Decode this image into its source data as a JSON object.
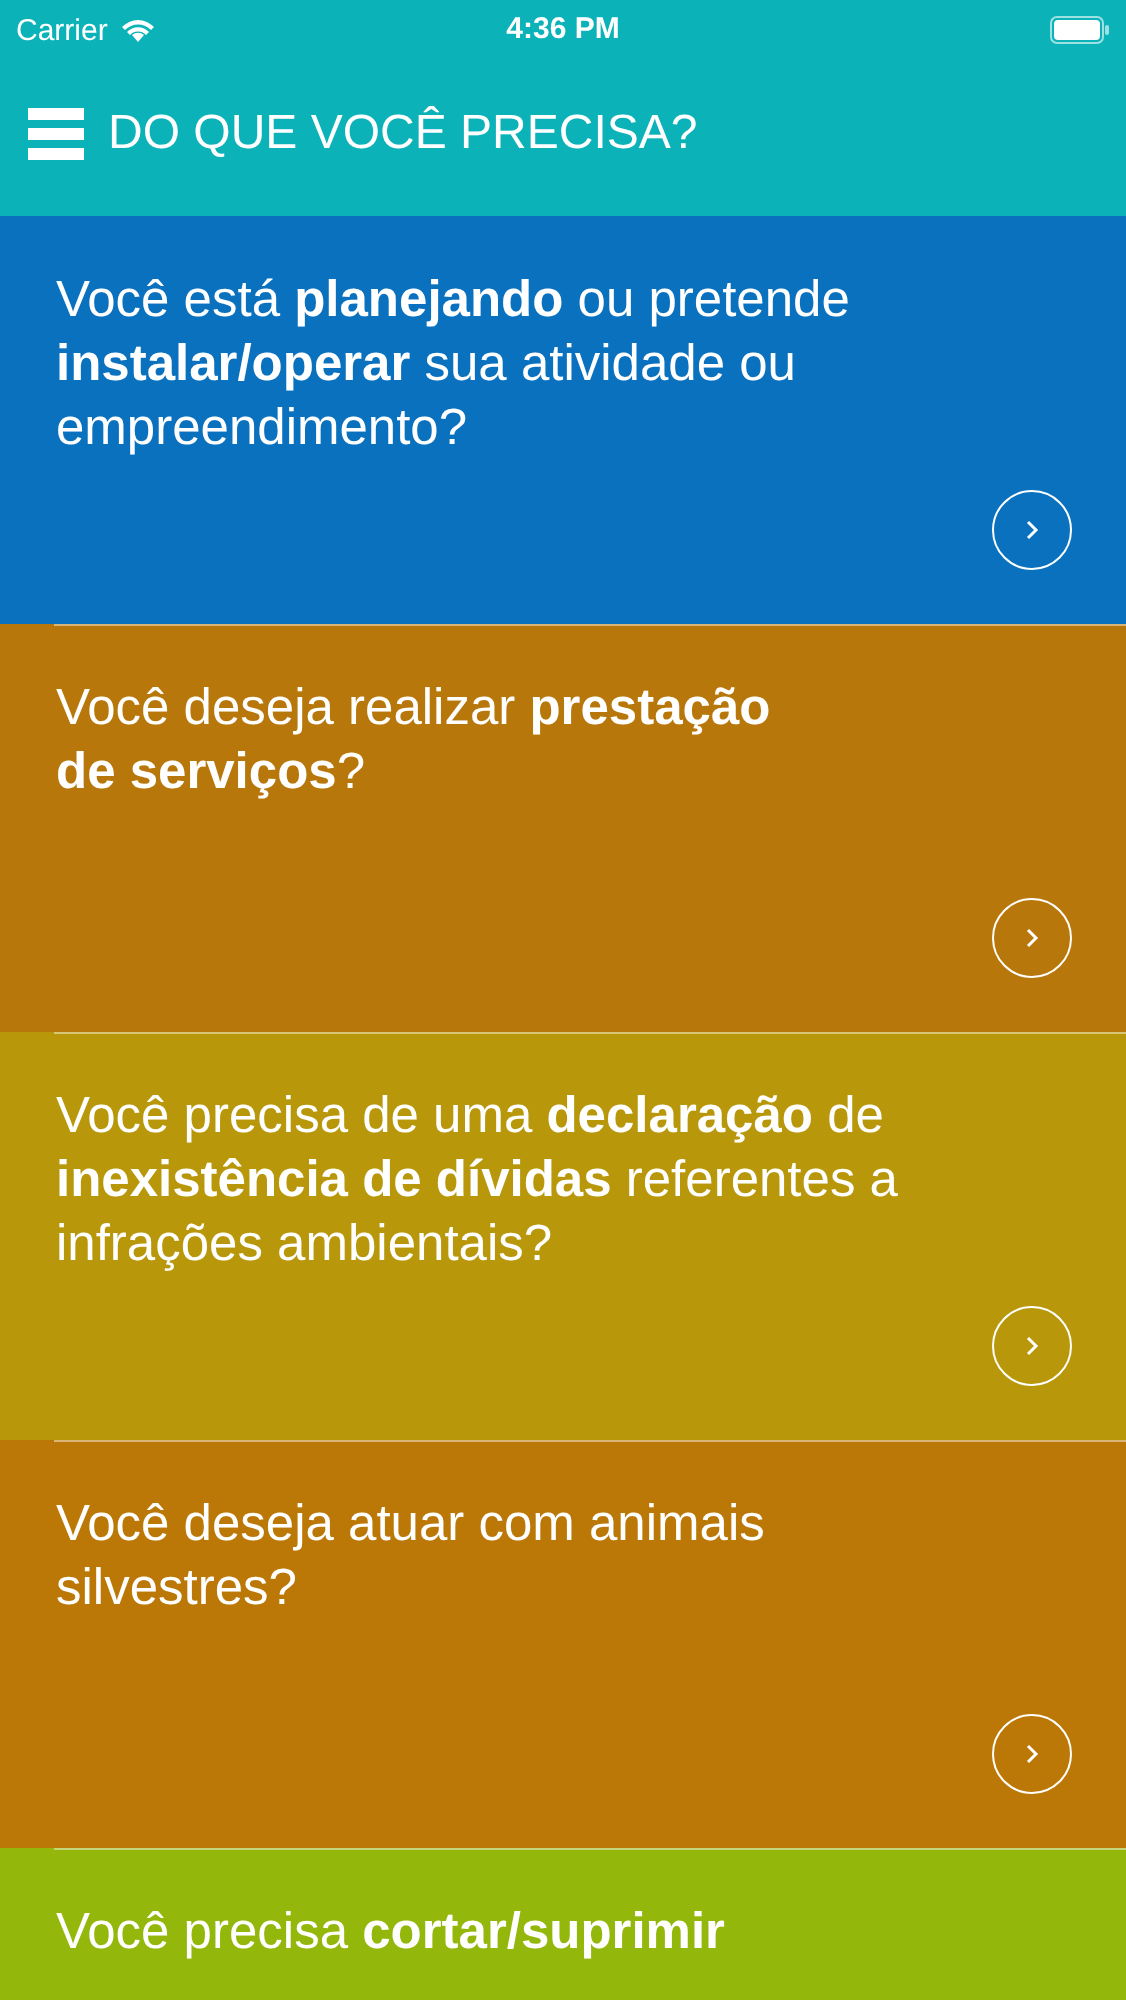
{
  "status_bar": {
    "carrier": "Carrier",
    "time": "4:36 PM"
  },
  "nav": {
    "title": "DO QUE VOCÊ PRECISA?"
  },
  "cards": [
    {
      "lines": [
        "Você está **planejando** ou pretende",
        "**instalar/operar** sua atividade ou",
        "empreendimento?"
      ],
      "color": "#0a71bf",
      "has_button": true
    },
    {
      "lines": [
        "Você deseja realizar **prestação**",
        "**de serviços**?"
      ],
      "color": "#b8770a",
      "has_button": true
    },
    {
      "lines": [
        "Você precisa de uma **declaração** de",
        "**inexistência de dívidas** referentes a",
        "infrações ambientais?"
      ],
      "color": "#b8980a",
      "has_button": true
    },
    {
      "lines": [
        "Você deseja atuar com animais",
        "silvestres?"
      ],
      "color": "#bb7806",
      "has_button": true
    },
    {
      "lines": [
        "Você precisa **cortar/suprimir**"
      ],
      "color": "#93b70a"
    }
  ]
}
